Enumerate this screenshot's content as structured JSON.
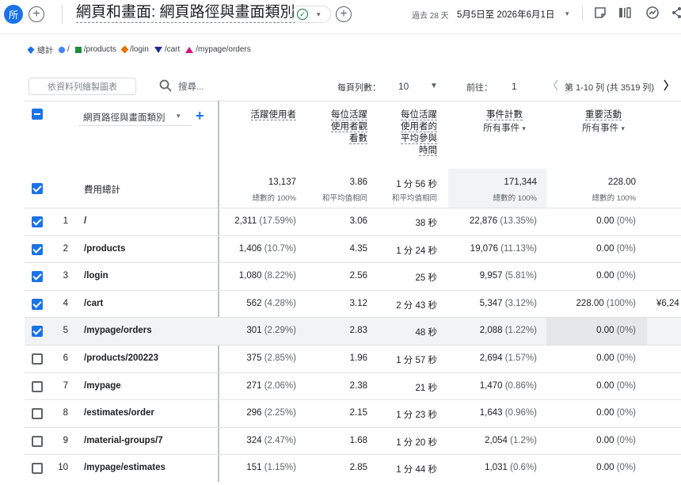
{
  "header": {
    "avatar_text": "所",
    "add_symbol": "+",
    "title": "網頁和畫面: 網頁路徑與畫面類別",
    "check_symbol": "✓",
    "caret_symbol": "▾",
    "date_label": "過去 28 天",
    "date_range": "5月5日至 2026年6月1日",
    "date_caret": "▾"
  },
  "legend": [
    {
      "label": "總計",
      "shape": "diamond-pin",
      "color": "#1a73e8"
    },
    {
      "label": "/",
      "shape": "circle",
      "color": "#4285f4"
    },
    {
      "label": "/products",
      "shape": "square",
      "color": "#1e8e3e"
    },
    {
      "label": "/login",
      "shape": "diamond",
      "color": "#e8710a"
    },
    {
      "label": "/cart",
      "shape": "triangle-down",
      "color": "#1f2f8a"
    },
    {
      "label": "/mypage/orders",
      "shape": "triangle-up",
      "color": "#d01884"
    }
  ],
  "toolbar": {
    "chart_button": "依資料列繪製圖表",
    "search_placeholder": "搜尋...",
    "rows_per_page_label": "每頁列數：",
    "rows_per_page_value": "10",
    "goto_label": "前往：",
    "goto_value": "1",
    "pagination_text": "第 1-10 列 (共 3519 列)",
    "prev_symbol": "〈",
    "next_symbol": "〉"
  },
  "table": {
    "dimension_select": "網頁路徑與畫面類別",
    "add_dimension": "+",
    "columns": [
      {
        "lines": [
          "活躍使用者"
        ]
      },
      {
        "lines": [
          "每位活躍",
          "使用者觀",
          "看數"
        ]
      },
      {
        "lines": [
          "每位活躍",
          "使用者的",
          "平均參與",
          "時間"
        ]
      },
      {
        "lines": [
          "事件計數"
        ],
        "sub": "所有事件"
      },
      {
        "lines": [
          "重要活動"
        ],
        "sub": "所有事件"
      }
    ],
    "totals": {
      "label": "費用總計",
      "values": [
        "13,137",
        "3.86",
        "1 分 56 秒",
        "171,344",
        "228.00"
      ],
      "subs": [
        "總數的 100%",
        "和平均值相同",
        "和平均值相同",
        "總數的 100%",
        "總數的 100%"
      ]
    },
    "rows": [
      {
        "idx": "1",
        "page": "/",
        "users": "2,311",
        "users_pct": "(17.59%)",
        "views": "3.06",
        "eng": "38 秒",
        "events": "22,876",
        "events_pct": "(13.35%)",
        "key": "0.00",
        "key_pct": "(0%)",
        "extra": "",
        "checked": true
      },
      {
        "idx": "2",
        "page": "/products",
        "users": "1,406",
        "users_pct": "(10.7%)",
        "views": "4.35",
        "eng": "1 分 24 秒",
        "events": "19,076",
        "events_pct": "(11.13%)",
        "key": "0.00",
        "key_pct": "(0%)",
        "extra": "",
        "checked": true
      },
      {
        "idx": "3",
        "page": "/login",
        "users": "1,080",
        "users_pct": "(8.22%)",
        "views": "2.56",
        "eng": "25 秒",
        "events": "9,957",
        "events_pct": "(5.81%)",
        "key": "0.00",
        "key_pct": "(0%)",
        "extra": "",
        "checked": true
      },
      {
        "idx": "4",
        "page": "/cart",
        "users": "562",
        "users_pct": "(4.28%)",
        "views": "3.12",
        "eng": "2 分 43 秒",
        "events": "5,347",
        "events_pct": "(3.12%)",
        "key": "228.00",
        "key_pct": "(100%)",
        "extra": "¥6,24",
        "checked": true
      },
      {
        "idx": "5",
        "page": "/mypage/orders",
        "users": "301",
        "users_pct": "(2.29%)",
        "views": "2.83",
        "eng": "48 秒",
        "events": "2,088",
        "events_pct": "(1.22%)",
        "key": "0.00",
        "key_pct": "(0%)",
        "extra": "",
        "checked": true
      },
      {
        "idx": "6",
        "page": "/products/200223",
        "users": "375",
        "users_pct": "(2.85%)",
        "views": "1.96",
        "eng": "1 分 57 秒",
        "events": "2,694",
        "events_pct": "(1.57%)",
        "key": "0.00",
        "key_pct": "(0%)",
        "extra": "",
        "checked": false
      },
      {
        "idx": "7",
        "page": "/mypage",
        "users": "271",
        "users_pct": "(2.06%)",
        "views": "2.38",
        "eng": "21 秒",
        "events": "1,470",
        "events_pct": "(0.86%)",
        "key": "0.00",
        "key_pct": "(0%)",
        "extra": "",
        "checked": false
      },
      {
        "idx": "8",
        "page": "/estimates/order",
        "users": "296",
        "users_pct": "(2.25%)",
        "views": "2.15",
        "eng": "1 分 23 秒",
        "events": "1,643",
        "events_pct": "(0.96%)",
        "key": "0.00",
        "key_pct": "(0%)",
        "extra": "",
        "checked": false
      },
      {
        "idx": "9",
        "page": "/material-groups/7",
        "users": "324",
        "users_pct": "(2.47%)",
        "views": "1.68",
        "eng": "1 分 20 秒",
        "events": "2,054",
        "events_pct": "(1.2%)",
        "key": "0.00",
        "key_pct": "(0%)",
        "extra": "",
        "checked": false
      },
      {
        "idx": "10",
        "page": "/mypage/estimates",
        "users": "151",
        "users_pct": "(1.15%)",
        "views": "2.85",
        "eng": "1 分 44 秒",
        "events": "1,031",
        "events_pct": "(0.6%)",
        "key": "0.00",
        "key_pct": "(0%)",
        "extra": "",
        "checked": false
      }
    ]
  }
}
